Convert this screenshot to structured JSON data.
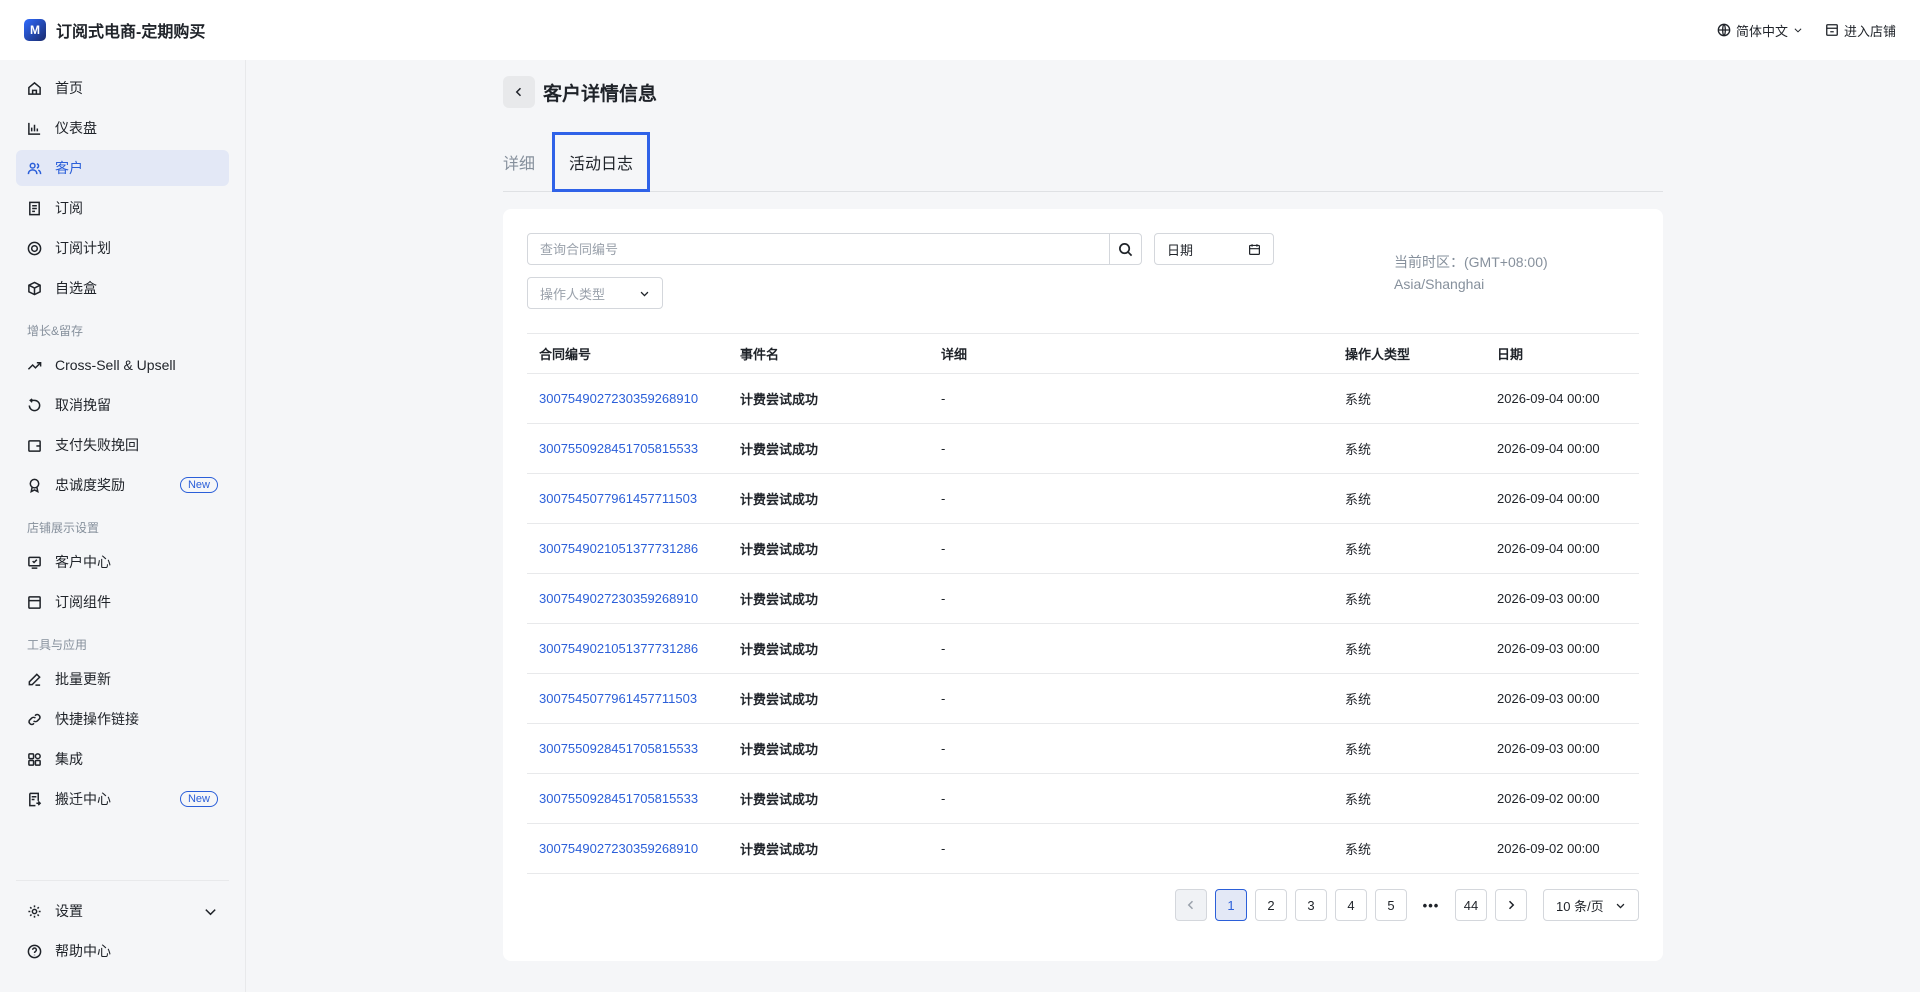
{
  "app": {
    "title": "订阅式电商-定期购买",
    "logo_glyph": "M"
  },
  "topbar": {
    "language": "简体中文",
    "enter_store": "进入店铺"
  },
  "sidebar": {
    "items": [
      {
        "label": "首页",
        "icon": "home-icon"
      },
      {
        "label": "仪表盘",
        "icon": "chart-icon"
      },
      {
        "label": "客户",
        "icon": "users-icon",
        "active": true
      },
      {
        "label": "订阅",
        "icon": "document-icon"
      },
      {
        "label": "订阅计划",
        "icon": "plan-icon"
      },
      {
        "label": "自选盒",
        "icon": "box-icon"
      }
    ],
    "section_growth": "增长&留存",
    "growth_items": [
      {
        "label": "Cross-Sell & Upsell",
        "icon": "trend-icon"
      },
      {
        "label": "取消挽留",
        "icon": "refresh-icon"
      },
      {
        "label": "支付失败挽回",
        "icon": "wallet-icon"
      },
      {
        "label": "忠诚度奖励",
        "icon": "badge-icon",
        "badge": "New"
      }
    ],
    "section_store": "店铺展示设置",
    "store_items": [
      {
        "label": "客户中心",
        "icon": "portal-icon"
      },
      {
        "label": "订阅组件",
        "icon": "widget-icon"
      }
    ],
    "section_tools": "工具与应用",
    "tool_items": [
      {
        "label": "批量更新",
        "icon": "edit-icon"
      },
      {
        "label": "快捷操作链接",
        "icon": "link-icon"
      },
      {
        "label": "集成",
        "icon": "apps-icon"
      },
      {
        "label": "搬迁中心",
        "icon": "migrate-icon",
        "badge": "New"
      }
    ],
    "bottom_items": [
      {
        "label": "设置",
        "icon": "gear-icon"
      },
      {
        "label": "帮助中心",
        "icon": "help-icon"
      }
    ]
  },
  "page": {
    "title": "客户详情信息"
  },
  "tabs": [
    {
      "label": "详细"
    },
    {
      "label": "活动日志",
      "active": true
    }
  ],
  "filters": {
    "search_placeholder": "查询合同编号",
    "date_label": "日期",
    "operator_placeholder": "操作人类型",
    "timezone_line1": "当前时区：(GMT+08:00)",
    "timezone_line2": "Asia/Shanghai"
  },
  "table": {
    "headers": [
      "合同编号",
      "事件名",
      "详细",
      "操作人类型",
      "日期"
    ],
    "rows": [
      [
        "300754902723035926891​0",
        "计费尝试成功",
        "-",
        "系统",
        "2026-09-04 00:00"
      ],
      [
        "3007550928451705815533",
        "计费尝试成功",
        "-",
        "系统",
        "2026-09-04 00:00"
      ],
      [
        "3007545077961457711503",
        "计费尝试成功",
        "-",
        "系统",
        "2026-09-04 00:00"
      ],
      [
        "3007549021051377731286",
        "计费尝试成功",
        "-",
        "系统",
        "2026-09-04 00:00"
      ],
      [
        "3007549027230359268910",
        "计费尝试成功",
        "-",
        "系统",
        "2026-09-03 00:00"
      ],
      [
        "3007549021051377731286",
        "计费尝试成功",
        "-",
        "系统",
        "2026-09-03 00:00"
      ],
      [
        "3007545077961457711503",
        "计费尝试成功",
        "-",
        "系统",
        "2026-09-03 00:00"
      ],
      [
        "3007550928451705815533",
        "计费尝试成功",
        "-",
        "系统",
        "2026-09-03 00:00"
      ],
      [
        "3007550928451705815533",
        "计费尝试成功",
        "-",
        "系统",
        "2026-09-02 00:00"
      ],
      [
        "3007549027230359268910",
        "计费尝试成功",
        "-",
        "系统",
        "2026-09-02 00:00"
      ]
    ]
  },
  "pagination": {
    "pages": [
      "1",
      "2",
      "3",
      "4",
      "5"
    ],
    "current": "1",
    "ellipsis": "•••",
    "last": "44",
    "page_size": "10 条/页"
  }
}
